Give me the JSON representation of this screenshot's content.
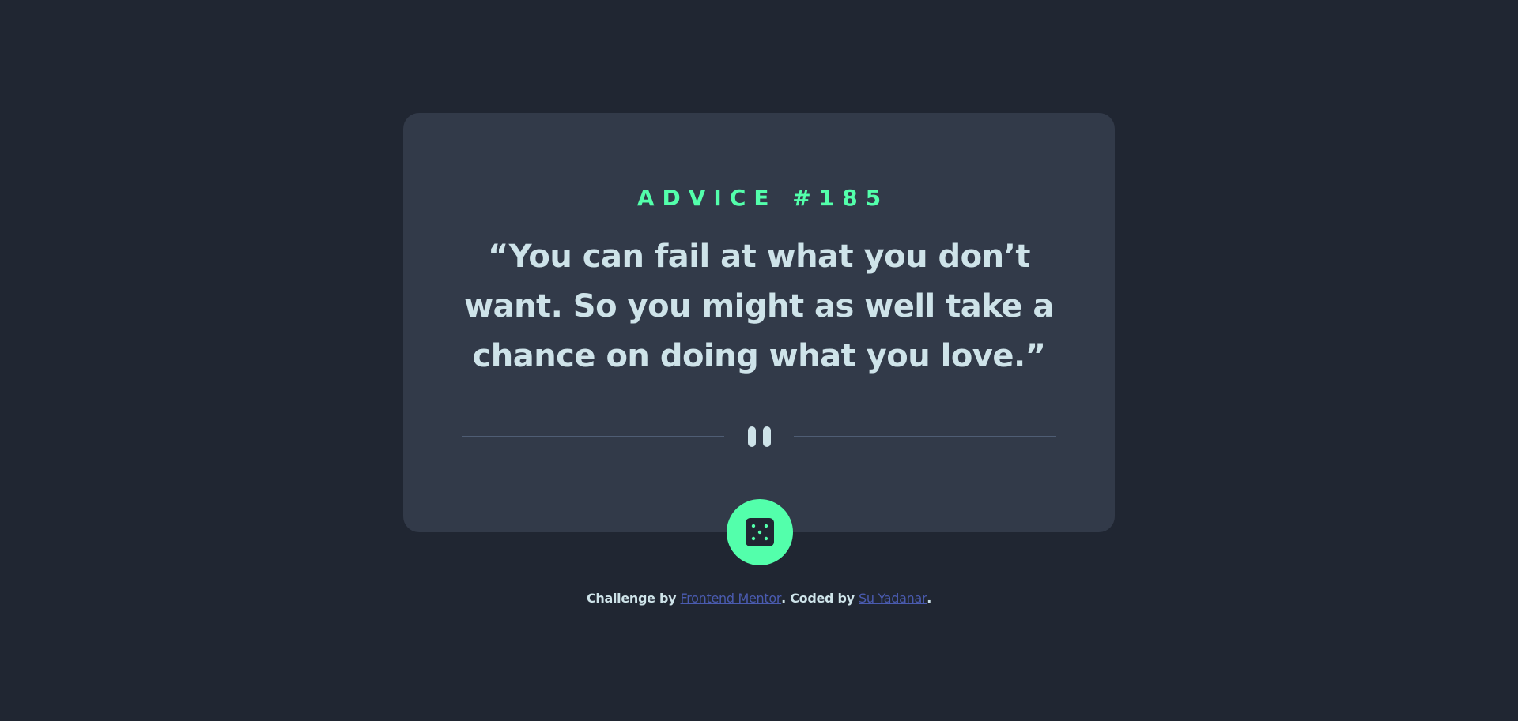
{
  "card": {
    "advice_id": "ADVICE #185",
    "quote": "“You can fail at what you don’t want. So you might as well take a chance on doing what you love.”"
  },
  "button": {
    "icon": "dice-icon"
  },
  "footer": {
    "prefix": "Challenge by ",
    "link1": "Frontend Mentor",
    "middle": ". Coded by ",
    "link2": "Su Yadanar",
    "suffix": "."
  },
  "colors": {
    "background": "#202632",
    "card": "#323a49",
    "accent": "#53ffab",
    "text": "#cee3e9",
    "divider": "#4f5d74",
    "link": "#4a5bb0"
  }
}
